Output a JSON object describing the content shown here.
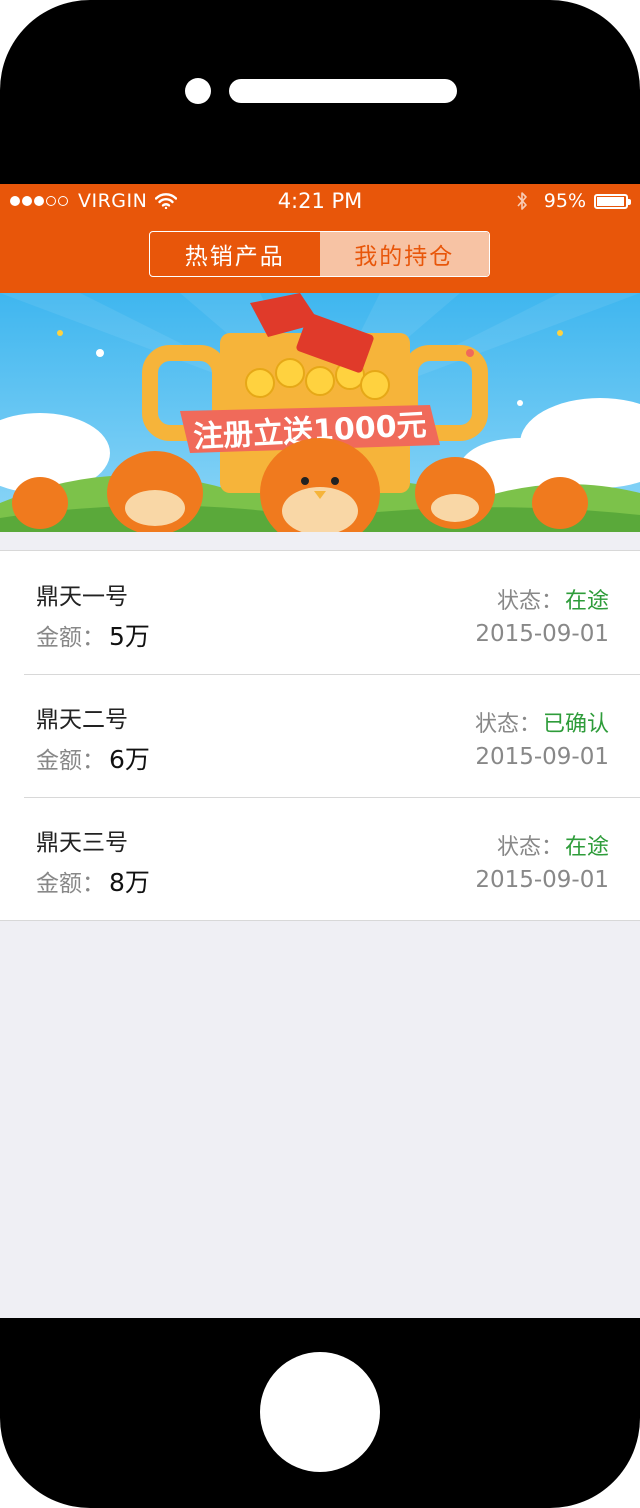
{
  "status_bar": {
    "signal_filled": 3,
    "signal_total": 5,
    "carrier": "VIRGIN",
    "time": "4:21 PM",
    "battery_text": "95%",
    "battery_level": 0.95
  },
  "tabs": [
    {
      "label": "热销产品",
      "selected": false
    },
    {
      "label": "我的持仓",
      "selected": true
    }
  ],
  "banner": {
    "headline": "注册立送1000元"
  },
  "holdings": [
    {
      "name": "鼎天一号",
      "amount_label": "金额：",
      "amount": "5万",
      "status_label": "状态：",
      "status": "在途",
      "date": "2015-09-01"
    },
    {
      "name": "鼎天二号",
      "amount_label": "金额：",
      "amount": "6万",
      "status_label": "状态：",
      "status": "已确认",
      "date": "2015-09-01"
    },
    {
      "name": "鼎天三号",
      "amount_label": "金额：",
      "amount": "8万",
      "status_label": "状态：",
      "status": "在途",
      "date": "2015-09-01"
    }
  ],
  "colors": {
    "accent": "#e8560a",
    "status_green": "#2e9c3a",
    "selected_tab_bg": "#f7c3a4",
    "screen_bg": "#efeff4"
  }
}
